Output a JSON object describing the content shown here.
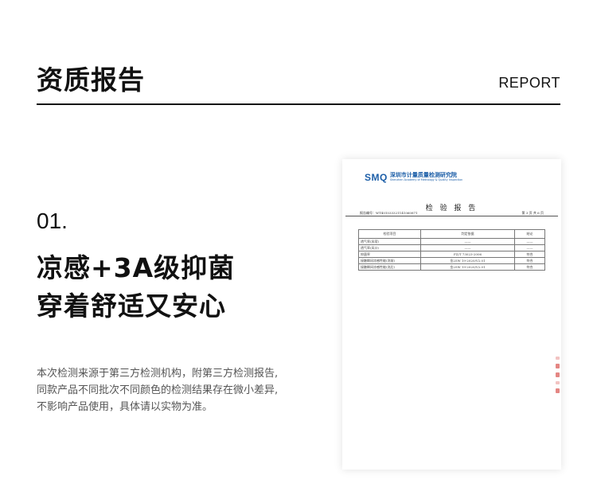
{
  "header": {
    "title": "资质报告",
    "subtitle": "REPORT"
  },
  "section": {
    "number": "01.",
    "headline": [
      "凉感+3A级抑菌",
      "穿着舒适又安心"
    ],
    "description": [
      "本次检测来源于第三方检测机构，附第三方检测报告,",
      "同款产品不同批次不同颜色的检测结果存在微小差异,",
      "不影响产品使用，具体请以实物为准。"
    ]
  },
  "report": {
    "logo_text": "SMQ",
    "org_cn": "深圳市计量质量检测研究院",
    "org_en": "Shenzhen Academy of Metrology & Quality Inspection",
    "title": "检 验 报 告",
    "report_no": "报告编号：WT401033321141060871",
    "page_info": "第 3 页 共 6 页",
    "table": {
      "headers": [
        "检验项目",
        "判定依据",
        "结论"
      ],
      "rows": [
        [
          "透气率(风荷)",
          "——",
          "——"
        ],
        [
          "透气率(风口)",
          "——",
          "——"
        ],
        [
          "抑菌率",
          "FZ/T 73023-2006",
          "符合"
        ],
        [
          "接触瞬间凉感性能(洗前)",
          "金25W 19-2020/V2.01",
          "符合"
        ],
        [
          "接触瞬间凉感性能(洗后)",
          "金25W 19-2020/V2.01",
          "符合"
        ]
      ]
    }
  }
}
